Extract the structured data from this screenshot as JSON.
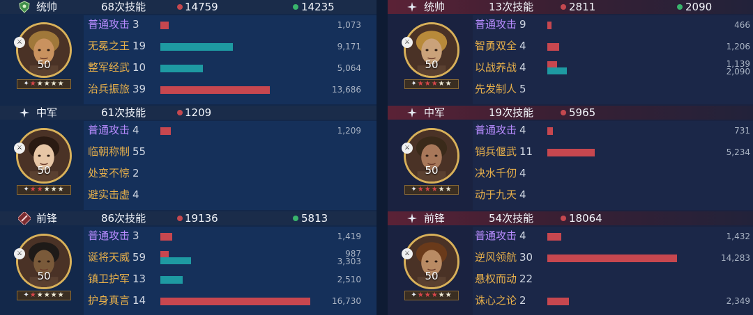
{
  "left": {
    "sections": [
      {
        "role": "统帅",
        "role_icon": "shield-icon",
        "casts": "68次技能",
        "stat_red": "14759",
        "stat_green": "14235",
        "level": "50",
        "stars_red": 1,
        "stars_total": 5,
        "skills": [
          {
            "name": "普通攻击",
            "count": "3",
            "type": "normal",
            "bars": [
              {
                "color": "red",
                "pct": 0.04,
                "label": "1,073"
              }
            ]
          },
          {
            "name": "无冕之王",
            "count": "19",
            "type": "skill",
            "bars": [
              {
                "color": "teal",
                "pct": 0.36,
                "label": "9,171"
              }
            ]
          },
          {
            "name": "整军经武",
            "count": "10",
            "type": "skill",
            "bars": [
              {
                "color": "teal",
                "pct": 0.21,
                "label": "5,064"
              }
            ]
          },
          {
            "name": "治兵振旅",
            "count": "39",
            "type": "skill",
            "bars": [
              {
                "color": "red",
                "pct": 0.54,
                "label": "13,686"
              }
            ]
          }
        ]
      },
      {
        "role": "中军",
        "role_icon": "sparkle-icon",
        "casts": "61次技能",
        "stat_red": "1209",
        "stat_green": "",
        "level": "50",
        "stars_red": 2,
        "stars_total": 5,
        "skills": [
          {
            "name": "普通攻击",
            "count": "4",
            "type": "normal",
            "bars": [
              {
                "color": "red",
                "pct": 0.05,
                "label": "1,209"
              }
            ]
          },
          {
            "name": "临朝称制",
            "count": "55",
            "type": "skill",
            "bars": []
          },
          {
            "name": "处变不惊",
            "count": "2",
            "type": "skill",
            "bars": []
          },
          {
            "name": "避实击虚",
            "count": "4",
            "type": "skill",
            "bars": []
          }
        ]
      },
      {
        "role": "前锋",
        "role_icon": "sword-icon",
        "casts": "86次技能",
        "stat_red": "19136",
        "stat_green": "5813",
        "level": "50",
        "stars_red": 1,
        "stars_total": 5,
        "skills": [
          {
            "name": "普通攻击",
            "count": "3",
            "type": "normal",
            "bars": [
              {
                "color": "red",
                "pct": 0.06,
                "label": "1,419"
              }
            ]
          },
          {
            "name": "诞将天威",
            "count": "59",
            "type": "skill",
            "bars": [
              {
                "color": "red",
                "pct": 0.04,
                "label": "987"
              },
              {
                "color": "teal",
                "pct": 0.15,
                "label": "3,303"
              }
            ]
          },
          {
            "name": "镇卫护军",
            "count": "13",
            "type": "skill",
            "bars": [
              {
                "color": "teal",
                "pct": 0.11,
                "label": "2,510"
              }
            ]
          },
          {
            "name": "护身真言",
            "count": "14",
            "type": "skill",
            "bars": [
              {
                "color": "red",
                "pct": 0.74,
                "label": "16,730"
              }
            ]
          }
        ]
      }
    ]
  },
  "right": {
    "sections": [
      {
        "role": "统帅",
        "role_icon": "sparkle-icon",
        "casts": "13次技能",
        "stat_red": "2811",
        "stat_green": "2090",
        "level": "50",
        "stars_red": 3,
        "stars_total": 5,
        "skills": [
          {
            "name": "普通攻击",
            "count": "9",
            "type": "normal",
            "bars": [
              {
                "color": "red",
                "pct": 0.02,
                "label": "466"
              }
            ]
          },
          {
            "name": "智勇双全",
            "count": "4",
            "type": "skill",
            "bars": [
              {
                "color": "red",
                "pct": 0.06,
                "label": "1,206"
              }
            ]
          },
          {
            "name": "以战养战",
            "count": "4",
            "type": "skill",
            "bars": [
              {
                "color": "red",
                "pct": 0.05,
                "label": "1,139"
              },
              {
                "color": "teal",
                "pct": 0.1,
                "label": "2,090"
              }
            ]
          },
          {
            "name": "先发制人",
            "count": "5",
            "type": "skill",
            "bars": []
          }
        ]
      },
      {
        "role": "中军",
        "role_icon": "sparkle-icon",
        "casts": "19次技能",
        "stat_red": "5965",
        "stat_green": "",
        "level": "50",
        "stars_red": 3,
        "stars_total": 5,
        "skills": [
          {
            "name": "普通攻击",
            "count": "4",
            "type": "normal",
            "bars": [
              {
                "color": "red",
                "pct": 0.03,
                "label": "731"
              }
            ]
          },
          {
            "name": "销兵偃武",
            "count": "11",
            "type": "skill",
            "bars": [
              {
                "color": "red",
                "pct": 0.24,
                "label": "5,234"
              }
            ]
          },
          {
            "name": "决水千仞",
            "count": "4",
            "type": "skill",
            "bars": []
          },
          {
            "name": "动于九天",
            "count": "4",
            "type": "skill",
            "bars": []
          }
        ]
      },
      {
        "role": "前锋",
        "role_icon": "sparkle-icon",
        "casts": "54次技能",
        "stat_red": "18064",
        "stat_green": "",
        "level": "50",
        "stars_red": 3,
        "stars_total": 5,
        "skills": [
          {
            "name": "普通攻击",
            "count": "4",
            "type": "normal",
            "bars": [
              {
                "color": "red",
                "pct": 0.07,
                "label": "1,432"
              }
            ]
          },
          {
            "name": "逆风领航",
            "count": "30",
            "type": "skill",
            "bars": [
              {
                "color": "red",
                "pct": 0.66,
                "label": "14,283"
              }
            ]
          },
          {
            "name": "悬权而动",
            "count": "22",
            "type": "skill",
            "bars": []
          },
          {
            "name": "诛心之论",
            "count": "2",
            "type": "skill",
            "bars": [
              {
                "color": "red",
                "pct": 0.11,
                "label": "2,349"
              }
            ]
          }
        ]
      }
    ]
  },
  "colors": {
    "damage": "#c7474f",
    "heal": "#1e9aa2",
    "normal_attack": "#b88cff",
    "skill": "#e8b04a",
    "stat_red_dot": "#c5484f",
    "stat_green_dot": "#39b46c"
  }
}
